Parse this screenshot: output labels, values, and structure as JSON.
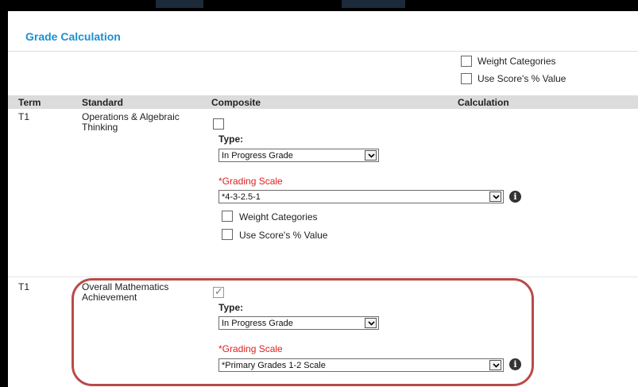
{
  "dialog": {
    "title": "Grade Calculation"
  },
  "top_options": {
    "weight_categories": "Weight Categories",
    "use_score_value": "Use Score's % Value"
  },
  "table": {
    "headers": {
      "term": "Term",
      "standard": "Standard",
      "composite": "Composite",
      "calculation": "Calculation"
    },
    "rows": [
      {
        "term": "T1",
        "standard": "Operations & Algebraic Thinking",
        "composite_checked": false,
        "type_label": "Type:",
        "type_value": "In Progress Grade",
        "scale_label": "*Grading Scale",
        "scale_value": "*4-3-2.5-1",
        "weight_categories": "Weight Categories",
        "use_score_value": "Use Score's % Value"
      },
      {
        "term": "T1",
        "standard": "Overall Mathematics Achievement",
        "composite_checked": true,
        "type_label": "Type:",
        "type_value": "In Progress Grade",
        "scale_label": "*Grading Scale",
        "scale_value": "*Primary Grades 1-2 Scale"
      }
    ]
  },
  "colors": {
    "title": "#1c8fd1",
    "required": "#e02020",
    "highlight": "#b94a4a"
  }
}
